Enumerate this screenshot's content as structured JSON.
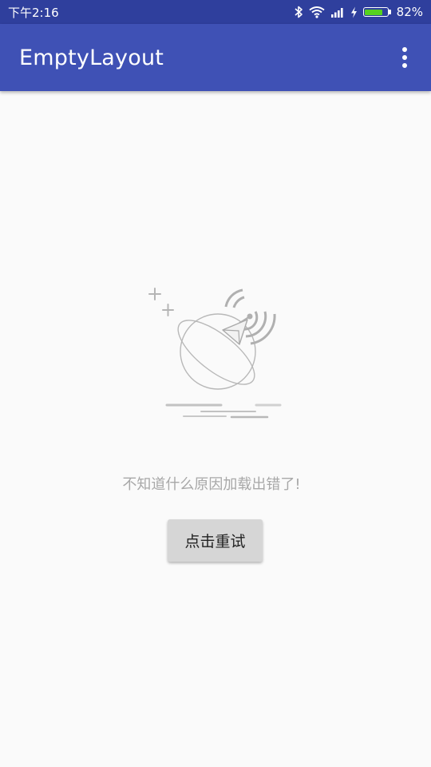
{
  "status_bar": {
    "time": "下午2:16",
    "battery_percent": "82%",
    "battery_level": 0.82,
    "icons": [
      "bluetooth-icon",
      "wifi-icon",
      "signal-icon",
      "charging-icon",
      "battery-icon"
    ]
  },
  "app_bar": {
    "title": "EmptyLayout",
    "menu_icon": "overflow-menu-icon"
  },
  "empty_state": {
    "illustration": "planet-satellite-icon",
    "message": "不知道什么原因加载出错了!",
    "retry_label": "点击重试"
  },
  "colors": {
    "status_bar": "#2f3f9d",
    "app_bar": "#3f51b5",
    "background": "#fafafa",
    "message_text": "#a8a8a8",
    "button_bg": "#d6d6d6",
    "battery_fill": "#56d11f"
  }
}
